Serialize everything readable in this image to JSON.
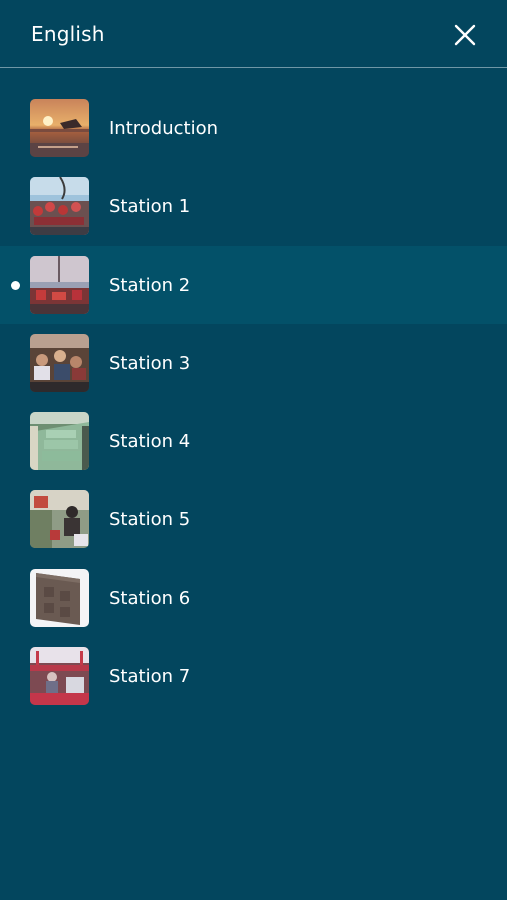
{
  "header": {
    "title": "English"
  },
  "menu": {
    "items": [
      {
        "label": "Introduction",
        "active": false
      },
      {
        "label": "Station 1",
        "active": false
      },
      {
        "label": "Station 2",
        "active": true
      },
      {
        "label": "Station 3",
        "active": false
      },
      {
        "label": "Station 4",
        "active": false
      },
      {
        "label": "Station 5",
        "active": false
      },
      {
        "label": "Station 6",
        "active": false
      },
      {
        "label": "Station 7",
        "active": false
      }
    ]
  },
  "colors": {
    "background": "#03465e",
    "active_row": "#035169",
    "divider": "#6f97a6",
    "text": "#ffffff"
  },
  "icons": {
    "close": "close-icon",
    "active_marker": "active-dot-icon"
  }
}
